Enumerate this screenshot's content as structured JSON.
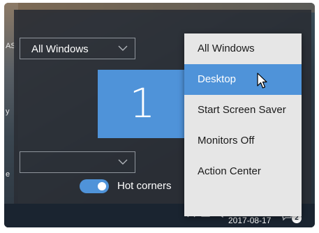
{
  "left_edge_fragments": [
    "AS",
    "y",
    "e"
  ],
  "panel": {
    "top_dropdown": {
      "value": "All Windows"
    },
    "bottom_dropdown": {
      "value": ""
    },
    "monitor_number": "1",
    "hot_corners": {
      "label": "Hot corners",
      "enabled": true
    }
  },
  "menu": {
    "items": [
      {
        "label": "All Windows",
        "selected": false
      },
      {
        "label": "Desktop",
        "selected": true
      },
      {
        "label": "Start Screen Saver",
        "selected": false
      },
      {
        "label": "Monitors Off",
        "selected": false
      },
      {
        "label": "Action Center",
        "selected": false
      }
    ]
  },
  "taskbar": {
    "date": "2017-08-17",
    "notification_count": "2"
  },
  "colors": {
    "accent": "#4f93d9",
    "panel_bg": "#2a2e34",
    "menu_bg": "#e6e6e6"
  }
}
